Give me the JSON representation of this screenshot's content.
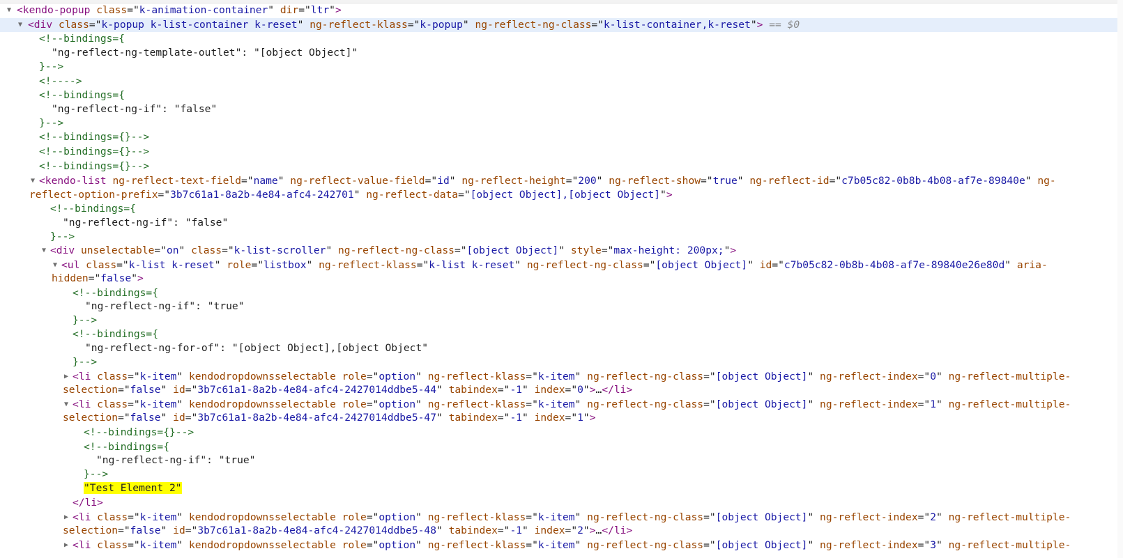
{
  "l01": {
    "tag": "kendo-popup",
    "a1": "class",
    "v1": "k-animation-container",
    "a2": "dir",
    "v2": "ltr"
  },
  "l02": {
    "tag": "div",
    "a1": "class",
    "v1": "k-popup k-list-container k-reset",
    "a2": "ng-reflect-klass",
    "v2": "k-popup",
    "a3": "ng-reflect-ng-class",
    "v3": "k-list-container,k-reset",
    "eq": "== $0"
  },
  "l03": "<!--bindings={",
  "l04": "\"ng-reflect-ng-template-outlet\": \"[object Object]\"",
  "l05": "}-->",
  "l06": "<!---->",
  "l07": "<!--bindings={",
  "l08": "\"ng-reflect-ng-if\": \"false\"",
  "l09": "}-->",
  "l10": "<!--bindings={}-->",
  "l11": "<!--bindings={}-->",
  "l12": "<!--bindings={}-->",
  "l13": {
    "tag": "kendo-list",
    "a1": "ng-reflect-text-field",
    "v1": "name",
    "a2": "ng-reflect-value-field",
    "v2": "id",
    "a3": "ng-reflect-height",
    "v3": "200",
    "a4": "ng-reflect-show",
    "v4": "true",
    "a5": "ng-reflect-id",
    "v5": "c7b05c82-0b8b-4b08-af7e-89840e",
    "a6": "ng-"
  },
  "l14": {
    "a1": "reflect-option-prefix",
    "v1": "3b7c61a1-8a2b-4e84-afc4-242701",
    "a2": "ng-reflect-data",
    "v2": "[object Object],[object Object]"
  },
  "l15": "<!--bindings={",
  "l16": "\"ng-reflect-ng-if\": \"false\"",
  "l17": "}-->",
  "l18": {
    "tag": "div",
    "a1": "unselectable",
    "v1": "on",
    "a2": "class",
    "v2": "k-list-scroller",
    "a3": "ng-reflect-ng-class",
    "v3": "[object Object]",
    "a4": "style",
    "v4": "max-height: 200px;"
  },
  "l19": {
    "tag": "ul",
    "a1": "class",
    "v1": "k-list k-reset",
    "a2": "role",
    "v2": "listbox",
    "a3": "ng-reflect-klass",
    "v3": "k-list k-reset",
    "a4": "ng-reflect-ng-class",
    "v4": "[object Object]",
    "a5": "id",
    "v5": "c7b05c82-0b8b-4b08-af7e-89840e26e80d",
    "a6": "aria-"
  },
  "l20": {
    "a1": "hidden",
    "v1": "false"
  },
  "l21": "<!--bindings={",
  "l22": "\"ng-reflect-ng-if\": \"true\"",
  "l23": "}-->",
  "l24": "<!--bindings={",
  "l25": "\"ng-reflect-ng-for-of\": \"[object Object],[object Object\"",
  "l26": "}-->",
  "li": {
    "tag": "li",
    "a1": "class",
    "v1": "k-item",
    "a2": "kendodropdownsselectable",
    "a3": "role",
    "v3": "option",
    "a4": "ng-reflect-klass",
    "v4": "k-item",
    "a5": "ng-reflect-ng-class",
    "v5": "[object Object]",
    "a6": "ng-reflect-index",
    "a7": "ng-reflect-multiple-",
    "cont_a1": "selection",
    "cont_v1": "false",
    "cont_a2": "id",
    "cont_a3": "tabindex",
    "cont_v3": "-1",
    "cont_a4": "index",
    "ellipsis": "…",
    "close": "</li>"
  },
  "l27": {
    "idx": "0",
    "id": "3b7c61a1-8a2b-4e84-afc4-2427014ddbe5-44",
    "index": "0"
  },
  "l29": {
    "idx": "1",
    "id": "3b7c61a1-8a2b-4e84-afc4-2427014ddbe5-47",
    "index": "1"
  },
  "l31": "<!--bindings={}-->",
  "l32": "<!--bindings={",
  "l33": "\"ng-reflect-ng-if\": \"true\"",
  "l34": "}-->",
  "l35": "\"Test Element 2\"",
  "l36": "</li>",
  "l37": {
    "idx": "2",
    "id": "3b7c61a1-8a2b-4e84-afc4-2427014ddbe5-48",
    "index": "2"
  },
  "l39": {
    "idx": "3"
  }
}
